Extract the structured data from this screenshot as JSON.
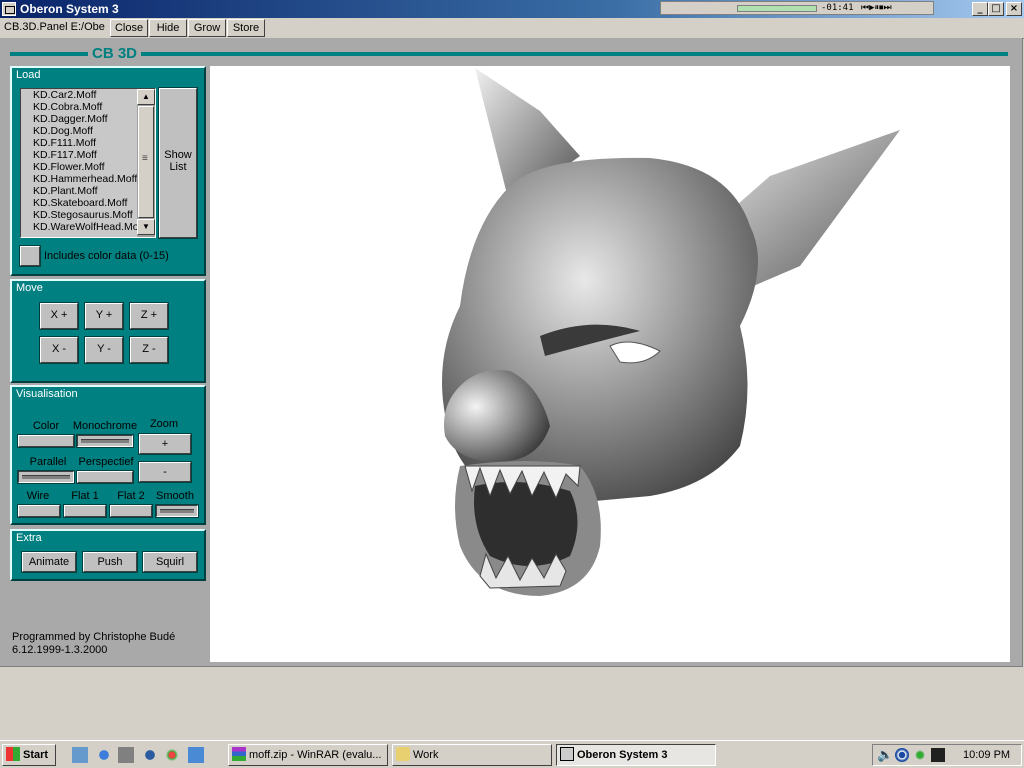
{
  "window": {
    "title": "Oberon System 3",
    "controls": {
      "minimize": "_",
      "maximize": "□",
      "close": "×"
    }
  },
  "media_player": {
    "time": "-01:41"
  },
  "toolbar": {
    "panel_name": "CB.3D.Panel E:/Obe",
    "buttons": [
      "Close",
      "Hide",
      "Grow",
      "Store"
    ]
  },
  "panel": {
    "title": "CB 3D",
    "load": {
      "label": "Load",
      "files": [
        "KD.Car2.Moff",
        "KD.Cobra.Moff",
        "KD.Dagger.Moff",
        "KD.Dog.Moff",
        "KD.F111.Moff",
        "KD.F117.Moff",
        "KD.Flower.Moff",
        "KD.Hammerhead.Moff",
        "KD.Plant.Moff",
        "KD.Skateboard.Moff",
        "KD.Stegosaurus.Moff",
        "KD.WareWolfHead.Moff"
      ],
      "show_list_line1": "Show",
      "show_list_line2": "List",
      "color_data_label": "Includes color data (0-15)"
    },
    "move": {
      "label": "Move",
      "buttons": [
        "X +",
        "Y +",
        "Z +",
        "X -",
        "Y -",
        "Z -"
      ]
    },
    "visualisation": {
      "label": "Visualisation",
      "color": "Color",
      "monochrome": "Monochrome",
      "zoom": "Zoom",
      "zoom_in": "+",
      "zoom_out": "-",
      "parallel": "Parallel",
      "perspective": "Perspectief",
      "wire": "Wire",
      "flat1": "Flat 1",
      "flat2": "Flat 2",
      "smooth": "Smooth",
      "selected": [
        "Monochrome",
        "Parallel",
        "Smooth"
      ]
    },
    "extra": {
      "label": "Extra",
      "buttons": [
        "Animate",
        "Push",
        "Squirl"
      ]
    },
    "credits_line1": "Programmed by  Christophe Budé",
    "credits_line2": "6.12.1999-1.3.2000"
  },
  "taskbar": {
    "start": "Start",
    "tasks": [
      "moff.zip - WinRAR (evalu...",
      "Work",
      "Oberon System 3"
    ],
    "active_task": "Oberon System 3",
    "clock": "10:09 PM"
  },
  "colors": {
    "panel": "#008080",
    "canvas": "#ffffff",
    "background": "#a9a9a9",
    "titlebar": "#0a246a"
  }
}
